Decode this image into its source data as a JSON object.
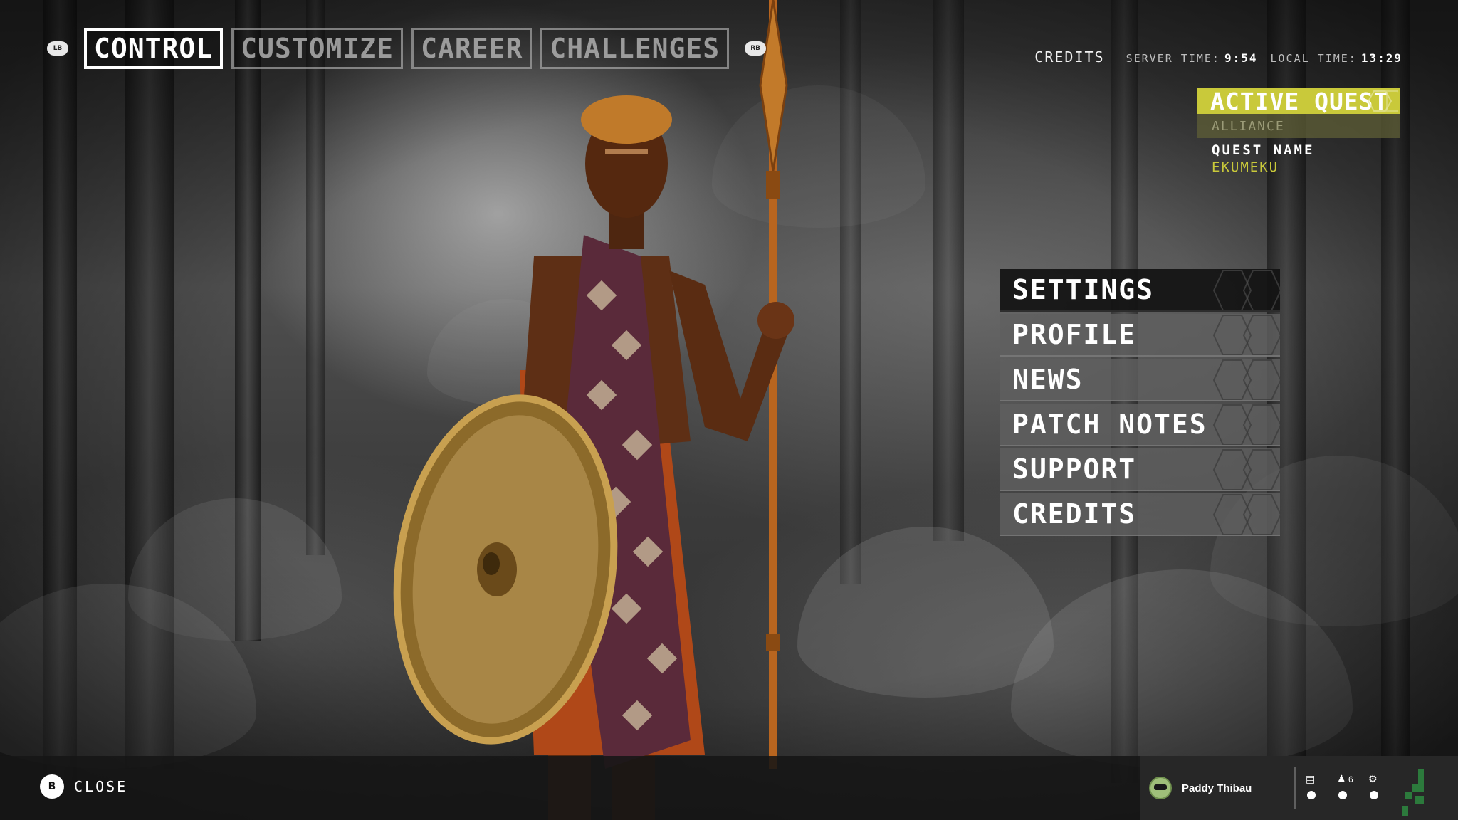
{
  "nav": {
    "left_bumper": "LB",
    "right_bumper": "RB",
    "tabs": [
      {
        "label": "CONTROL",
        "active": true
      },
      {
        "label": "CUSTOMIZE",
        "active": false
      },
      {
        "label": "CAREER",
        "active": false
      },
      {
        "label": "CHALLENGES",
        "active": false
      }
    ]
  },
  "header": {
    "credits_label": "CREDITS",
    "server_time_label": "SERVER TIME:",
    "server_time": "9:54",
    "local_time_label": "LOCAL TIME:",
    "local_time": "13:29"
  },
  "quest": {
    "title": "ACTIVE QUEST",
    "faction": "ALLIANCE",
    "name_label": "QUEST NAME",
    "name": "EKUMEKU",
    "accent_color": "#c9c93a"
  },
  "menu": {
    "items": [
      {
        "label": "SETTINGS",
        "selected": true
      },
      {
        "label": "PROFILE",
        "selected": false
      },
      {
        "label": "NEWS",
        "selected": false
      },
      {
        "label": "PATCH NOTES",
        "selected": false
      },
      {
        "label": "SUPPORT",
        "selected": false
      },
      {
        "label": "CREDITS",
        "selected": false
      }
    ]
  },
  "footer": {
    "close_button_glyph": "B",
    "close_label": "CLOSE",
    "username": "Paddy Thibau",
    "chat_icon": "chat-icon",
    "friends_icon": "friends-icon",
    "friends_count": "6",
    "settings_icon": "gear-icon"
  }
}
